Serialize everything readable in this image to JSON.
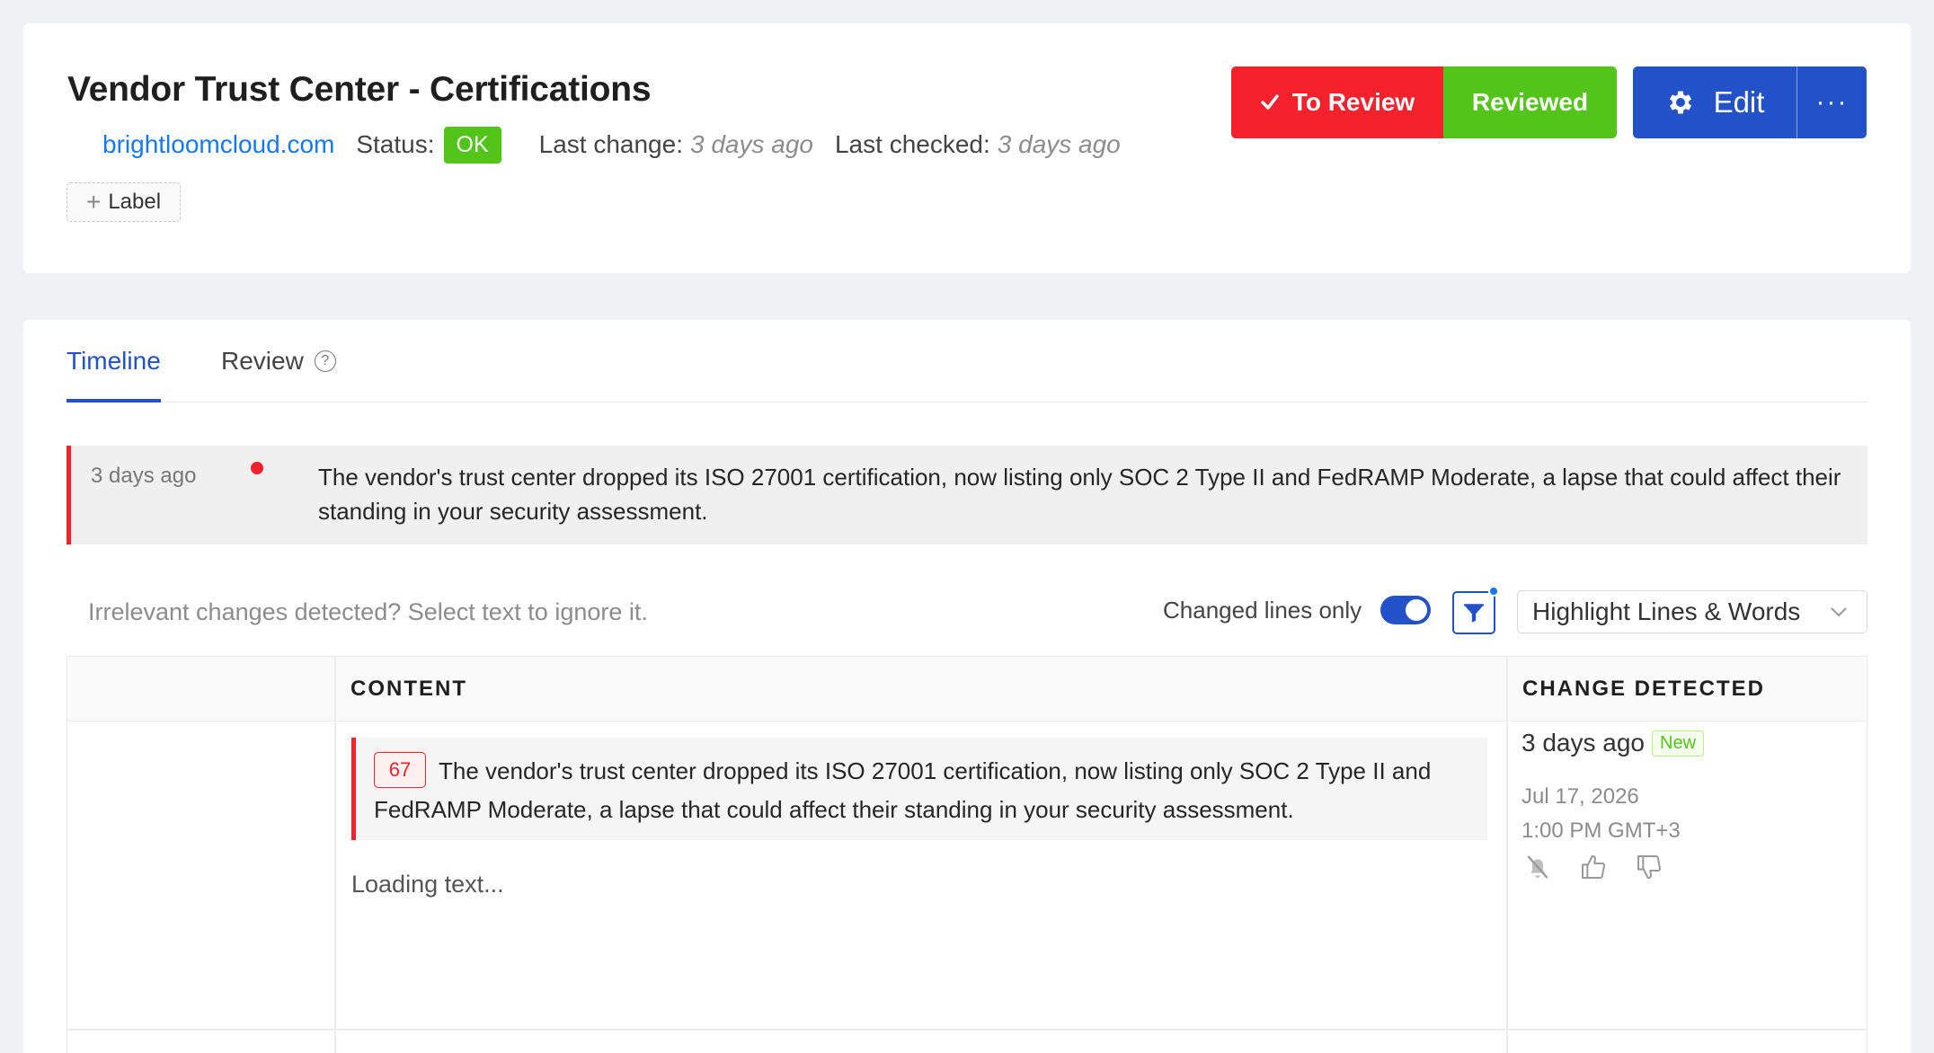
{
  "header": {
    "title": "Vendor Trust Center - Certifications",
    "domain": "brightloomcloud.com",
    "status_label": "Status:",
    "status_value": "OK",
    "last_change_label": "Last change:",
    "last_change_value": "3 days ago",
    "last_checked_label": "Last checked:",
    "last_checked_value": "3 days ago",
    "label_button": "Label"
  },
  "actions": {
    "to_review": "To Review",
    "reviewed": "Reviewed",
    "edit": "Edit",
    "more": "···"
  },
  "tabs": {
    "timeline": "Timeline",
    "review": "Review",
    "review_help": "?"
  },
  "summary": {
    "time": "3 days ago",
    "text": "The vendor's trust center dropped its ISO 27001 certification, now listing only SOC 2 Type II and FedRAMP Moderate, a lapse that could affect their standing in your security assessment."
  },
  "toolbar": {
    "hint": "Irrelevant changes detected? Select text to ignore it.",
    "changed_lines_label": "Changed lines only",
    "changed_lines_on": true,
    "highlight_mode": "Highlight Lines & Words"
  },
  "table": {
    "col_content": "CONTENT",
    "col_change": "CHANGE DETECTED",
    "row": {
      "line_number": "67",
      "text": "The vendor's trust center dropped its ISO 27001 certification, now listing only SOC 2 Type II and FedRAMP Moderate, a lapse that could affect their standing in your security assessment.",
      "loading": "Loading text...",
      "detected_ago": "3 days ago",
      "badge": "New",
      "date": "Jul 17, 2026",
      "time": "1:00 PM GMT+3"
    }
  },
  "colors": {
    "accent": "#2251c8",
    "danger": "#f5222d",
    "success": "#52c41a",
    "link": "#1677ff"
  },
  "icons": [
    "check-icon",
    "plus-icon",
    "gear-icon",
    "more-icon",
    "help-icon",
    "filter-icon",
    "chevron-down-icon",
    "mute-bell-icon",
    "thumbs-up-icon",
    "thumbs-down-icon"
  ]
}
